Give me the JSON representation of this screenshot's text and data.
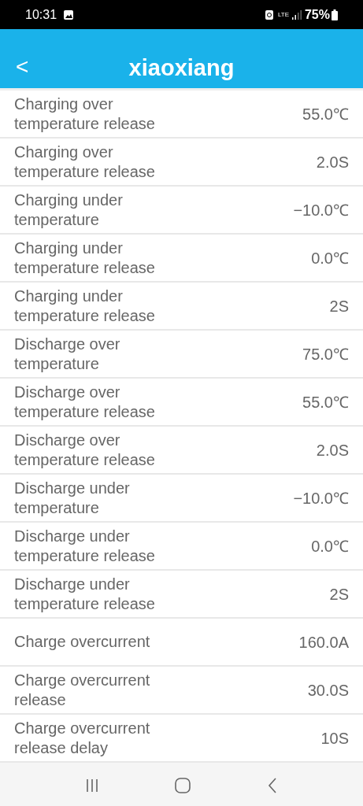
{
  "status_bar": {
    "time": "10:31",
    "network": "LTE",
    "battery": "75%"
  },
  "app_bar": {
    "back": "<",
    "title": "xiaoxiang"
  },
  "rows": [
    {
      "label": "Charging over temperature release",
      "value": "55.0℃"
    },
    {
      "label": "Charging over temperature release",
      "value": "2.0S"
    },
    {
      "label": "Charging under temperature",
      "value": "−10.0℃"
    },
    {
      "label": "Charging under temperature release",
      "value": "0.0℃"
    },
    {
      "label": "Charging under temperature release",
      "value": "2S"
    },
    {
      "label": "Discharge over temperature",
      "value": "75.0℃"
    },
    {
      "label": "Discharge over temperature release",
      "value": "55.0℃"
    },
    {
      "label": "Discharge over temperature release",
      "value": "2.0S"
    },
    {
      "label": "Discharge under temperature",
      "value": "−10.0℃"
    },
    {
      "label": "Discharge under temperature release",
      "value": "0.0℃"
    },
    {
      "label": "Discharge under temperature release",
      "value": "2S"
    },
    {
      "label": "Charge overcurrent",
      "value": "160.0A"
    },
    {
      "label": "Charge overcurrent release",
      "value": "30.0S"
    },
    {
      "label": "Charge overcurrent release delay",
      "value": "10S"
    }
  ]
}
